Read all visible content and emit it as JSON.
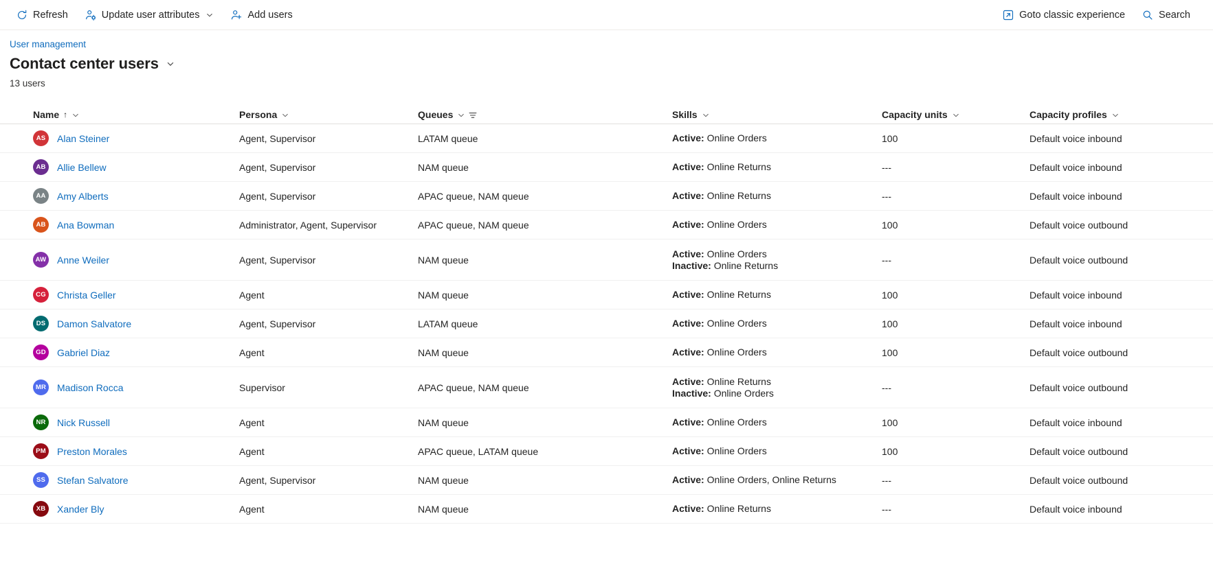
{
  "command_bar": {
    "left_items": [
      {
        "label": "Refresh",
        "icon": "refresh-icon",
        "has_chevron": false
      },
      {
        "label": "Update user attributes",
        "icon": "user-settings-icon",
        "has_chevron": true
      },
      {
        "label": "Add users",
        "icon": "add-user-icon",
        "has_chevron": false
      }
    ],
    "right_items": [
      {
        "label": "Goto classic experience",
        "icon": "open-in-new-icon",
        "has_chevron": false
      },
      {
        "label": "Search",
        "icon": "search-icon",
        "has_chevron": false
      }
    ]
  },
  "header": {
    "breadcrumb": "User management",
    "title": "Contact center users",
    "title_chevron_icon": "chevron-down-icon",
    "count_label": "13 users"
  },
  "table": {
    "columns": [
      {
        "label": "Name",
        "sort_indicator": "↑",
        "has_chevron": true,
        "has_filter": false
      },
      {
        "label": "Persona",
        "sort_indicator": "",
        "has_chevron": true,
        "has_filter": false
      },
      {
        "label": "Queues",
        "sort_indicator": "",
        "has_chevron": true,
        "has_filter": true
      },
      {
        "label": "Skills",
        "sort_indicator": "",
        "has_chevron": true,
        "has_filter": false
      },
      {
        "label": "Capacity units",
        "sort_indicator": "",
        "has_chevron": true,
        "has_filter": false
      },
      {
        "label": "Capacity profiles",
        "sort_indicator": "",
        "has_chevron": true,
        "has_filter": false
      }
    ],
    "rows": [
      {
        "initials": "AS",
        "avatar_color": "#d13438",
        "name": "Alan Steiner",
        "persona": "Agent, Supervisor",
        "queues": "LATAM queue",
        "skills": [
          {
            "state": "Active:",
            "value": "Online Orders"
          }
        ],
        "capacity_units": "100",
        "capacity_profiles": "Default voice inbound"
      },
      {
        "initials": "AB",
        "avatar_color": "#6b2d90",
        "name": "Allie Bellew",
        "persona": "Agent, Supervisor",
        "queues": "NAM queue",
        "skills": [
          {
            "state": "Active:",
            "value": "Online Returns"
          }
        ],
        "capacity_units": "---",
        "capacity_profiles": "Default voice inbound"
      },
      {
        "initials": "AA",
        "avatar_color": "#7a8386",
        "name": "Amy Alberts",
        "persona": "Agent, Supervisor",
        "queues": "APAC queue, NAM queue",
        "skills": [
          {
            "state": "Active:",
            "value": "Online Returns"
          }
        ],
        "capacity_units": "---",
        "capacity_profiles": "Default voice inbound"
      },
      {
        "initials": "AB",
        "avatar_color": "#d9541b",
        "name": "Ana Bowman",
        "persona": "Administrator, Agent, Supervisor",
        "queues": "APAC queue, NAM queue",
        "skills": [
          {
            "state": "Active:",
            "value": "Online Orders"
          }
        ],
        "capacity_units": "100",
        "capacity_profiles": "Default voice outbound"
      },
      {
        "initials": "AW",
        "avatar_color": "#8430a8",
        "name": "Anne Weiler",
        "persona": "Agent, Supervisor",
        "queues": "NAM queue",
        "skills": [
          {
            "state": "Active:",
            "value": "Online Orders"
          },
          {
            "state": "Inactive:",
            "value": "Online Returns"
          }
        ],
        "capacity_units": "---",
        "capacity_profiles": "Default voice outbound"
      },
      {
        "initials": "CG",
        "avatar_color": "#d6213b",
        "name": "Christa Geller",
        "persona": "Agent",
        "queues": "NAM queue",
        "skills": [
          {
            "state": "Active:",
            "value": "Online Returns"
          }
        ],
        "capacity_units": "100",
        "capacity_profiles": "Default voice inbound"
      },
      {
        "initials": "DS",
        "avatar_color": "#036b70",
        "name": "Damon Salvatore",
        "persona": "Agent, Supervisor",
        "queues": "LATAM queue",
        "skills": [
          {
            "state": "Active:",
            "value": "Online Orders"
          }
        ],
        "capacity_units": "100",
        "capacity_profiles": "Default voice inbound"
      },
      {
        "initials": "GD",
        "avatar_color": "#b4009e",
        "name": "Gabriel Diaz",
        "persona": "Agent",
        "queues": "NAM queue",
        "skills": [
          {
            "state": "Active:",
            "value": "Online Orders"
          }
        ],
        "capacity_units": "100",
        "capacity_profiles": "Default voice outbound"
      },
      {
        "initials": "MR",
        "avatar_color": "#4f6bed",
        "name": "Madison Rocca",
        "persona": "Supervisor",
        "queues": "APAC queue, NAM queue",
        "skills": [
          {
            "state": "Active:",
            "value": "Online Returns"
          },
          {
            "state": "Inactive:",
            "value": "Online Orders"
          }
        ],
        "capacity_units": "---",
        "capacity_profiles": "Default voice outbound"
      },
      {
        "initials": "NR",
        "avatar_color": "#0b6a0b",
        "name": "Nick Russell",
        "persona": "Agent",
        "queues": "NAM queue",
        "skills": [
          {
            "state": "Active:",
            "value": "Online Orders"
          }
        ],
        "capacity_units": "100",
        "capacity_profiles": "Default voice inbound"
      },
      {
        "initials": "PM",
        "avatar_color": "#9b0d18",
        "name": "Preston Morales",
        "persona": "Agent",
        "queues": "APAC queue, LATAM queue",
        "skills": [
          {
            "state": "Active:",
            "value": "Online Orders"
          }
        ],
        "capacity_units": "100",
        "capacity_profiles": "Default voice outbound"
      },
      {
        "initials": "SS",
        "avatar_color": "#4f6bed",
        "name": "Stefan Salvatore",
        "persona": "Agent, Supervisor",
        "queues": "NAM queue",
        "skills": [
          {
            "state": "Active:",
            "value": "Online Orders, Online Returns"
          }
        ],
        "capacity_units": "---",
        "capacity_profiles": "Default voice outbound"
      },
      {
        "initials": "XB",
        "avatar_color": "#86090f",
        "name": "Xander Bly",
        "persona": "Agent",
        "queues": "NAM queue",
        "skills": [
          {
            "state": "Active:",
            "value": "Online Returns"
          }
        ],
        "capacity_units": "---",
        "capacity_profiles": "Default voice inbound"
      }
    ]
  },
  "colors": {
    "link": "#0f6cbd",
    "text": "#242424",
    "divider": "#f0f0f0",
    "header_divider": "#e1dfdd"
  }
}
